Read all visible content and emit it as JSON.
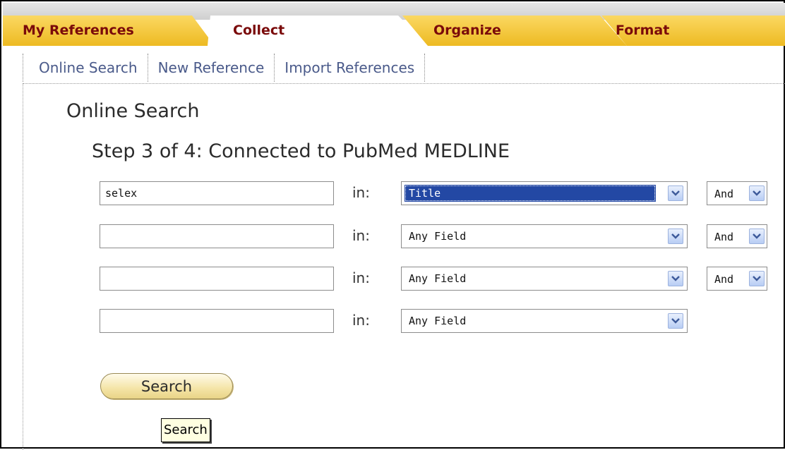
{
  "tabs": [
    {
      "label": "My References",
      "active": false
    },
    {
      "label": "Collect",
      "active": true
    },
    {
      "label": "Organize",
      "active": false
    },
    {
      "label": "Format",
      "active": false
    }
  ],
  "subnav": [
    "Online Search",
    "New Reference",
    "Import References"
  ],
  "page_title": "Online Search",
  "step_title": "Step 3 of 4: Connected to PubMed MEDLINE",
  "search_rows": [
    {
      "term": "selex",
      "in_label": "in:",
      "field": "Title",
      "field_selected": true,
      "operator": "And"
    },
    {
      "term": "",
      "in_label": "in:",
      "field": "Any Field",
      "field_selected": false,
      "operator": "And"
    },
    {
      "term": "",
      "in_label": "in:",
      "field": "Any Field",
      "field_selected": false,
      "operator": "And"
    },
    {
      "term": "",
      "in_label": "in:",
      "field": "Any Field",
      "field_selected": false,
      "operator": null
    }
  ],
  "search_button_label": "Search",
  "tooltip": "Search",
  "colors": {
    "tab_yellow": "#f2c230",
    "tab_active": "#ffffff",
    "tab_label": "#7a0a0a",
    "subnav_link": "#4a5a8a",
    "selection_blue": "#2348a4",
    "button_fill": "#f4e4a6",
    "tooltip_fill": "#ffffe1"
  },
  "icons": {
    "dropdown": "chevron-down-icon"
  }
}
